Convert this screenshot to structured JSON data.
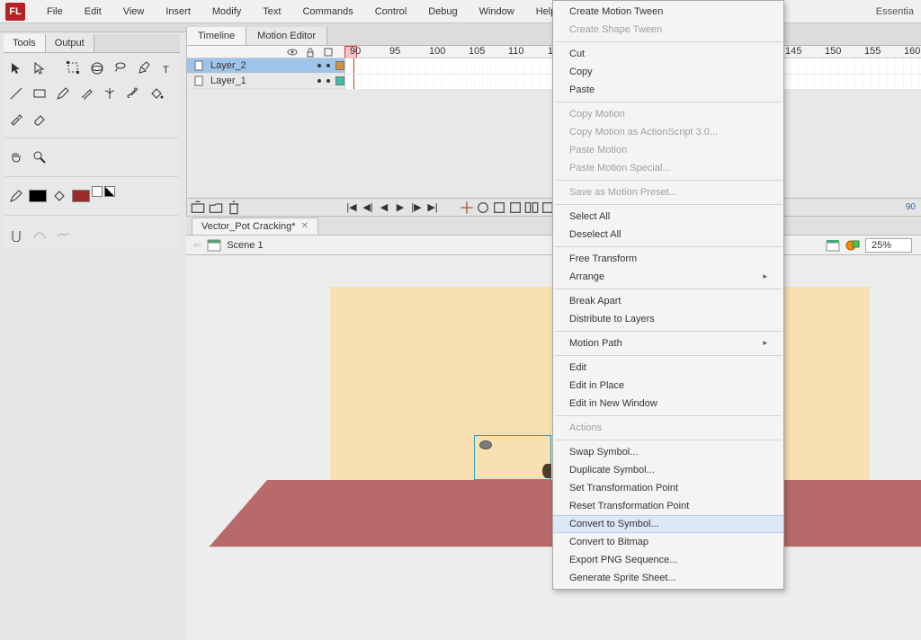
{
  "app": {
    "logo": "FL",
    "workspace": "Essentia"
  },
  "menu": [
    "File",
    "Edit",
    "View",
    "Insert",
    "Modify",
    "Text",
    "Commands",
    "Control",
    "Debug",
    "Window",
    "Help"
  ],
  "panels": {
    "tools_tabs": [
      "Tools",
      "Output"
    ]
  },
  "timeline": {
    "tabs": [
      "Timeline",
      "Motion Editor"
    ],
    "ruler": {
      "start": 90,
      "step": 5,
      "count": 16
    },
    "layers": [
      {
        "name": "Layer_2",
        "color": "orange",
        "selected": true
      },
      {
        "name": "Layer_1",
        "color": "teal",
        "selected": false
      }
    ],
    "current_frame": "90"
  },
  "document": {
    "title": "Vector_Pot Cracking*"
  },
  "scene": {
    "name": "Scene 1",
    "zoom": "25%"
  },
  "context_menu": {
    "items": [
      {
        "label": "Create Motion Tween"
      },
      {
        "label": "Create Shape Tween",
        "disabled": true
      },
      {
        "sep": true
      },
      {
        "label": "Cut"
      },
      {
        "label": "Copy"
      },
      {
        "label": "Paste"
      },
      {
        "sep": true
      },
      {
        "label": "Copy Motion",
        "disabled": true
      },
      {
        "label": "Copy Motion as ActionScript 3.0...",
        "disabled": true
      },
      {
        "label": "Paste Motion",
        "disabled": true
      },
      {
        "label": "Paste Motion Special...",
        "disabled": true
      },
      {
        "sep": true
      },
      {
        "label": "Save as Motion Preset...",
        "disabled": true
      },
      {
        "sep": true
      },
      {
        "label": "Select All"
      },
      {
        "label": "Deselect All"
      },
      {
        "sep": true
      },
      {
        "label": "Free Transform"
      },
      {
        "label": "Arrange",
        "submenu": true
      },
      {
        "sep": true
      },
      {
        "label": "Break Apart"
      },
      {
        "label": "Distribute to Layers"
      },
      {
        "sep": true
      },
      {
        "label": "Motion Path",
        "submenu": true
      },
      {
        "sep": true
      },
      {
        "label": "Edit"
      },
      {
        "label": "Edit in Place"
      },
      {
        "label": "Edit in New Window"
      },
      {
        "sep": true
      },
      {
        "label": "Actions",
        "disabled": true
      },
      {
        "sep": true
      },
      {
        "label": "Swap Symbol..."
      },
      {
        "label": "Duplicate Symbol..."
      },
      {
        "label": "Set Transformation Point"
      },
      {
        "label": "Reset Transformation Point"
      },
      {
        "label": "Convert to Symbol...",
        "hover": true
      },
      {
        "label": "Convert to Bitmap"
      },
      {
        "label": "Export PNG Sequence..."
      },
      {
        "label": "Generate Sprite Sheet..."
      }
    ]
  }
}
